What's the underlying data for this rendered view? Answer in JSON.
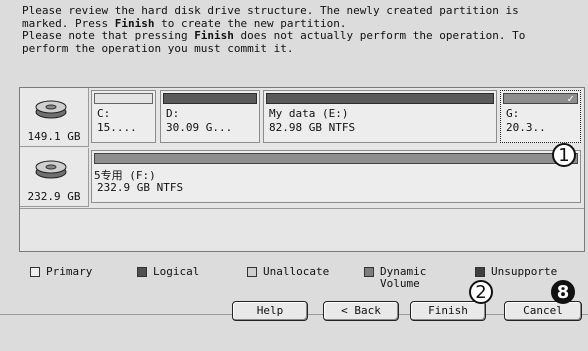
{
  "message": {
    "line1_a": "Please review the hard disk drive structure. The newly created partition is",
    "line2_a": "marked. Press ",
    "line2_b": "Finish",
    "line2_c": " to create the new partition.",
    "line3_a": "Please note that pressing ",
    "line3_b": "Finish",
    "line3_c": " does not actually perform the operation. To",
    "line4_a": "perform the operation you must commit it."
  },
  "disks": [
    {
      "size": "149.1 GB",
      "partitions": [
        {
          "line1": "C:",
          "line2": "15...."
        },
        {
          "line1": "D:",
          "line2": "30.09 G..."
        },
        {
          "line1": "My data (E:)",
          "line2": "82.98 GB  NTFS"
        },
        {
          "line1": "G:",
          "line2": "20.3.."
        }
      ]
    },
    {
      "size": "232.9 GB",
      "partitions": [
        {
          "line1": "5专用 (F:)",
          "line2": "232.9 GB  NTFS"
        }
      ]
    }
  ],
  "legend": {
    "primary": "Primary",
    "logical": "Logical",
    "unallocated": "Unallocate",
    "dynamic_1": "Dynamic",
    "dynamic_2": "Volume",
    "unsupported": "Unsupporte"
  },
  "buttons": {
    "help": "Help",
    "back": "< Back",
    "finish": "Finish",
    "cancel": "Cancel"
  },
  "callouts": {
    "c1": "1",
    "c2": "2",
    "c3": "8"
  },
  "icons": {
    "disk": "hard-disk-icon",
    "selected": "check-icon"
  }
}
